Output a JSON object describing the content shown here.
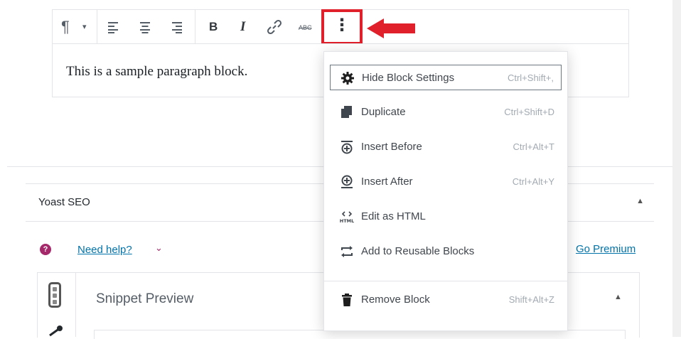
{
  "editor": {
    "paragraph_text": "This is a sample paragraph block.",
    "toolbar": {
      "paragraph_icon": "¶",
      "paragraph_caret": "▾",
      "bold": "B",
      "italic": "I",
      "strikethrough": "ABC",
      "more": "⋮"
    }
  },
  "block_menu": {
    "items": [
      {
        "label": "Hide Block Settings",
        "shortcut": "Ctrl+Shift+,",
        "icon": "gear-icon"
      },
      {
        "label": "Duplicate",
        "shortcut": "Ctrl+Shift+D",
        "icon": "duplicate-icon"
      },
      {
        "label": "Insert Before",
        "shortcut": "Ctrl+Alt+T",
        "icon": "insert-before-icon"
      },
      {
        "label": "Insert After",
        "shortcut": "Ctrl+Alt+Y",
        "icon": "insert-after-icon"
      },
      {
        "label": "Edit as HTML",
        "shortcut": "",
        "icon": "html-icon"
      },
      {
        "label": "Add to Reusable Blocks",
        "shortcut": "",
        "icon": "reusable-icon"
      },
      {
        "label": "Remove Block",
        "shortcut": "Shift+Alt+Z",
        "icon": "trash-icon"
      }
    ],
    "html_icon_text": "HTML"
  },
  "yoast": {
    "title": "Yoast SEO",
    "help_icon": "?",
    "help_link": "Need help?",
    "help_chevron": "⌄",
    "premium_dot": "·",
    "premium_link": "Go Premium",
    "collapse_icon": "▲",
    "snippet_title": "Snippet Preview",
    "snippet_collapse_icon": "▲"
  },
  "colors": {
    "highlight_red": "#e0202a",
    "link_blue": "#0073aa",
    "yoast_purple": "#a4286a"
  }
}
